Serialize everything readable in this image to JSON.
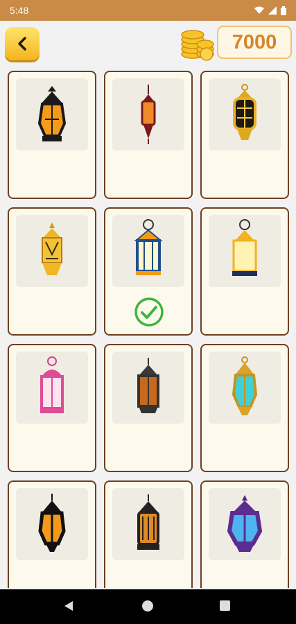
{
  "status_bar": {
    "time": "5:48",
    "icons": [
      "wifi-icon",
      "signal-icon",
      "battery-icon"
    ]
  },
  "header": {
    "back_icon": "chevron-left-icon",
    "coins_icon": "coin-stack-icon",
    "coin_count": "7000"
  },
  "lanterns": [
    {
      "name": "black-orange-lantern",
      "selected": false
    },
    {
      "name": "red-hanging-lantern",
      "selected": false
    },
    {
      "name": "gold-ornate-lantern",
      "selected": false
    },
    {
      "name": "gold-carved-lantern",
      "selected": false
    },
    {
      "name": "blue-orange-lantern",
      "selected": true
    },
    {
      "name": "navy-yellow-lantern",
      "selected": false
    },
    {
      "name": "pink-lantern",
      "selected": false
    },
    {
      "name": "dark-grey-lantern",
      "selected": false
    },
    {
      "name": "gold-teal-lantern",
      "selected": false
    },
    {
      "name": "black-silhouette-lantern",
      "selected": false
    },
    {
      "name": "black-bronze-lantern",
      "selected": false
    },
    {
      "name": "purple-blue-lantern",
      "selected": false
    }
  ],
  "selected_icon": "checkmark-icon",
  "nav_bar": {
    "icons": [
      "back-triangle-icon",
      "home-circle-icon",
      "recent-square-icon"
    ]
  }
}
